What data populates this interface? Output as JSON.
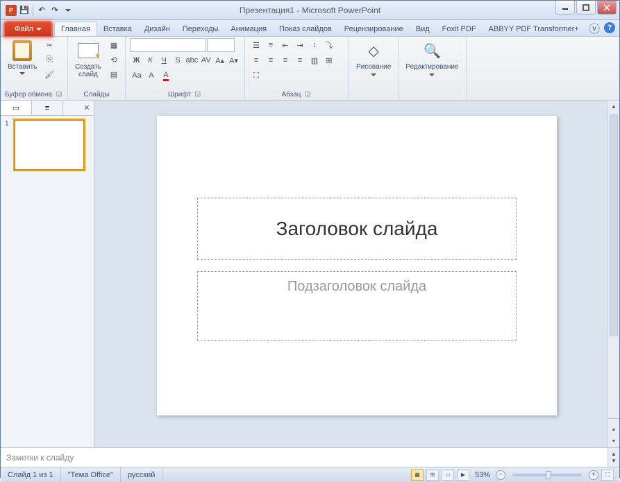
{
  "title": "Презентация1 - Microsoft PowerPoint",
  "qat_icons": [
    "save",
    "undo",
    "redo"
  ],
  "tabs": {
    "file": "Файл",
    "items": [
      "Главная",
      "Вставка",
      "Дизайн",
      "Переходы",
      "Анимация",
      "Показ слайдов",
      "Рецензирование",
      "Вид",
      "Foxit PDF",
      "ABBYY PDF Transformer+"
    ],
    "active": "Главная"
  },
  "ribbon": {
    "clipboard": {
      "paste": "Вставить",
      "label": "Буфер обмена"
    },
    "slides": {
      "new_slide": "Создать\nслайд",
      "label": "Слайды"
    },
    "font": {
      "label": "Шрифт",
      "name_placeholder": " ",
      "size_placeholder": " "
    },
    "paragraph": {
      "label": "Абзац"
    },
    "drawing": {
      "label": "Рисование"
    },
    "editing": {
      "label": "Редактирование"
    }
  },
  "left_panel": {
    "thumb_tab": "▭",
    "outline_tab": "≡",
    "slide_numbers": [
      "1"
    ]
  },
  "slide": {
    "title_placeholder": "Заголовок слайда",
    "subtitle_placeholder": "Подзаголовок слайда"
  },
  "notes": {
    "placeholder": "Заметки к слайду"
  },
  "statusbar": {
    "slide_info": "Слайд 1 из 1",
    "theme": "\"Тема Office\"",
    "language": "русский",
    "zoom": "53%"
  },
  "colors": {
    "accent": "#d04524"
  }
}
